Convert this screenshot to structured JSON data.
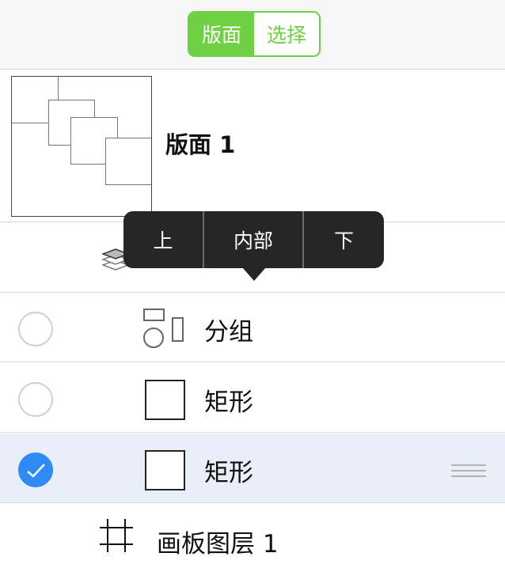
{
  "segmented": {
    "left_label": "版面",
    "right_label": "选择",
    "active": "left"
  },
  "canvas": {
    "name": "版面 1"
  },
  "popup_menu": {
    "items": [
      "上",
      "内部",
      "下"
    ]
  },
  "layers": [
    {
      "label": "分组",
      "icon": "group-icon",
      "checked": false
    },
    {
      "label": "矩形",
      "icon": "rectangle-icon",
      "checked": false
    },
    {
      "label": "矩形",
      "icon": "rectangle-icon",
      "checked": true
    }
  ],
  "artboard": {
    "label": "画板图层 1",
    "icon": "artboard-icon"
  },
  "colors": {
    "accent_green": "#6fcf45",
    "check_blue": "#2f8af5",
    "selected_row": "#e9eff9",
    "popup_bg": "#262626"
  }
}
